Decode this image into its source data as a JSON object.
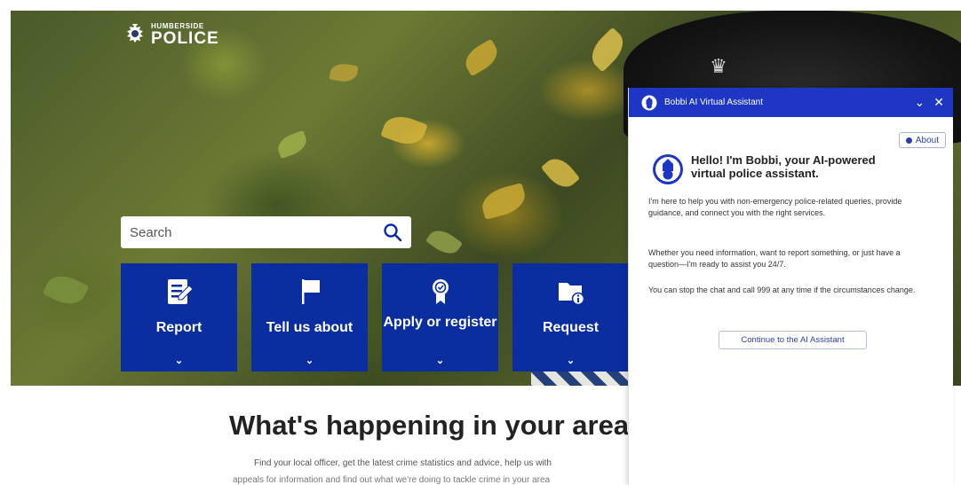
{
  "brand": {
    "small": "HUMBERSIDE",
    "big": "POLICE"
  },
  "search": {
    "placeholder": "Search"
  },
  "tiles": [
    {
      "label": "Report",
      "icon": "report-icon"
    },
    {
      "label": "Tell us about",
      "icon": "flag-icon"
    },
    {
      "label": "Apply or register",
      "icon": "award-icon"
    },
    {
      "label": "Request",
      "icon": "folder-info-icon"
    }
  ],
  "main": {
    "headline": "What's happening in your area",
    "intro_line1": "Find your local officer, get the latest crime statistics and advice, help us with",
    "intro_line2": "appeals for information and find out what we're doing to tackle crime in your area"
  },
  "chat": {
    "title": "Bobbi AI Virtual Assistant",
    "about_label": "About",
    "greeting": "Hello! I'm Bobbi, your AI-powered virtual police assistant.",
    "p1": "I'm here to help you with non-emergency police-related queries, provide guidance, and connect you with the right services.",
    "p2": "Whether you need information, want to report something, or just have a question—I'm ready to assist you 24/7.",
    "p3": "You can stop the chat and call 999 at any time if the circumstances change.",
    "continue_label": "Continue to the AI Assistant"
  },
  "colors": {
    "tile_blue": "#0a2da0",
    "chat_header": "#1e36c4",
    "link_blue": "#2a3fa8"
  }
}
